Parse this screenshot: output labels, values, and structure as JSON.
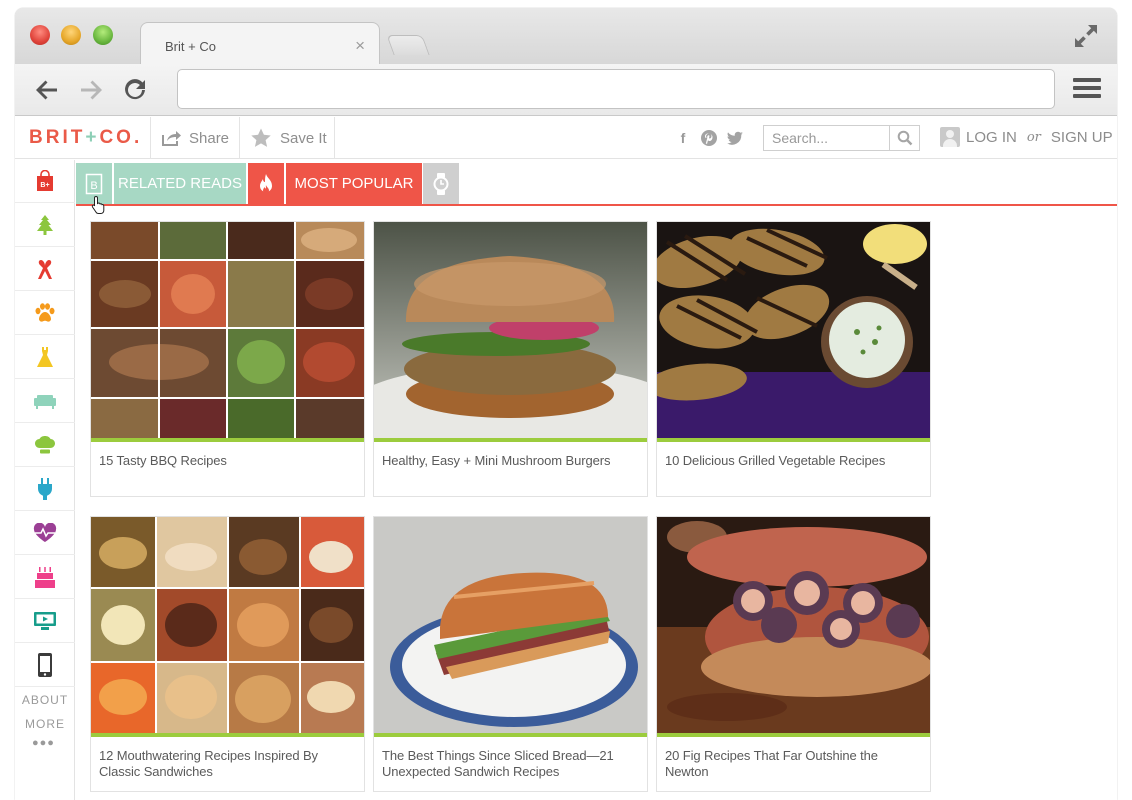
{
  "browser": {
    "tab_title": "Brit + Co",
    "tab_close": "×",
    "address": ""
  },
  "site": {
    "logo_left": "BRIT",
    "logo_plus": "+",
    "logo_right": "CO.",
    "share_label": "Share",
    "save_label": "Save It",
    "search_placeholder": "Search...",
    "login_label": "LOG IN",
    "or_label": "or",
    "signup_label": "SIGN UP"
  },
  "sidebar": {
    "about_label": "ABOUT",
    "more_label": "MORE",
    "dots": "●●●",
    "icons": [
      "shopping-bag-icon",
      "tree-icon",
      "ribbon-icon",
      "paw-icon",
      "dress-icon",
      "sofa-icon",
      "chef-hat-icon",
      "plug-icon",
      "heart-rate-icon",
      "cake-icon",
      "tv-icon",
      "phone-icon"
    ]
  },
  "tabs": {
    "b_label": "B",
    "related_label": "RELATED READS",
    "popular_label": "MOST POPULAR"
  },
  "cards": [
    {
      "caption": "15 Tasty BBQ Recipes"
    },
    {
      "caption": "Healthy, Easy + Mini Mushroom Burgers"
    },
    {
      "caption": "10 Delicious Grilled Vegetable Recipes"
    },
    {
      "caption": "12 Mouthwatering Recipes Inspired By Classic Sandwiches"
    },
    {
      "caption": "The Best Things Since Sliced Bread—21 Unexpected Sandwich Recipes"
    },
    {
      "caption": "20 Fig Recipes That Far Outshine the Newton"
    }
  ],
  "colors": {
    "brand_red": "#ef5548",
    "brand_mint": "#a7d8c4",
    "accent_green": "#9ccc3d"
  }
}
